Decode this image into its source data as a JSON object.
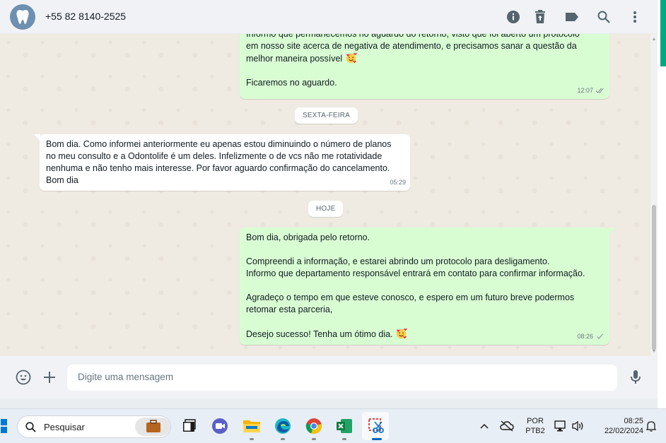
{
  "header": {
    "contact_phone": "+55 82 8140-2525",
    "icons": [
      "info-icon",
      "trash-icon",
      "label-icon",
      "search-icon",
      "menu-icon"
    ]
  },
  "messages": [
    {
      "direction": "outgoing",
      "text": "Informo que permanecemos no aguardo do retorno, visto que foi aberto um protocolo\nem nosso site acerca de negativa de atendimento, e precisamos sanar a questão da\nmelhor maneira possível",
      "text2": "Ficaremos no aguardo.",
      "time": "12:07",
      "status": "read"
    },
    {
      "type": "date",
      "label": "SEXTA-FEIRA"
    },
    {
      "direction": "incoming",
      "text": "Bom dia. Como informei anteriormente eu apenas estou diminuindo o número de planos\nno meu consulto e a Odontolife é um deles. Infelizmente o de vcs não me rotatividade\nnenhuma e não tenho mais interesse. Por favor aguardo confirmação do cancelamento.\nBom dia",
      "time": "05:29"
    },
    {
      "type": "date",
      "label": "HOJE"
    },
    {
      "direction": "outgoing",
      "text": "Bom dia, obrigada pelo retorno.\n\nCompreendi a informação, e estarei abrindo um protocolo para desligamento.\nInformo que departamento responsável entrará em contato para confirmar informação.\n\nAgradeço o tempo em que esteve conosco, e espero em um futuro breve podermos\nretomar esta parceria,\n\nDesejo sucesso! Tenha um ótimo dia.",
      "time": "08:26",
      "status": "delivered"
    }
  ],
  "composer": {
    "placeholder": "Digite uma mensagem"
  },
  "taskbar": {
    "search_label": "Pesquisar",
    "language": "POR",
    "layout": "PTB2",
    "time": "08:25",
    "date": "22/02/2024"
  },
  "colors": {
    "outgoing_bubble": "#d9fdd3",
    "incoming_bubble": "#ffffff",
    "accent": "#00a884",
    "header_bg": "#f0f2f5",
    "chat_bg": "#efeae2"
  }
}
